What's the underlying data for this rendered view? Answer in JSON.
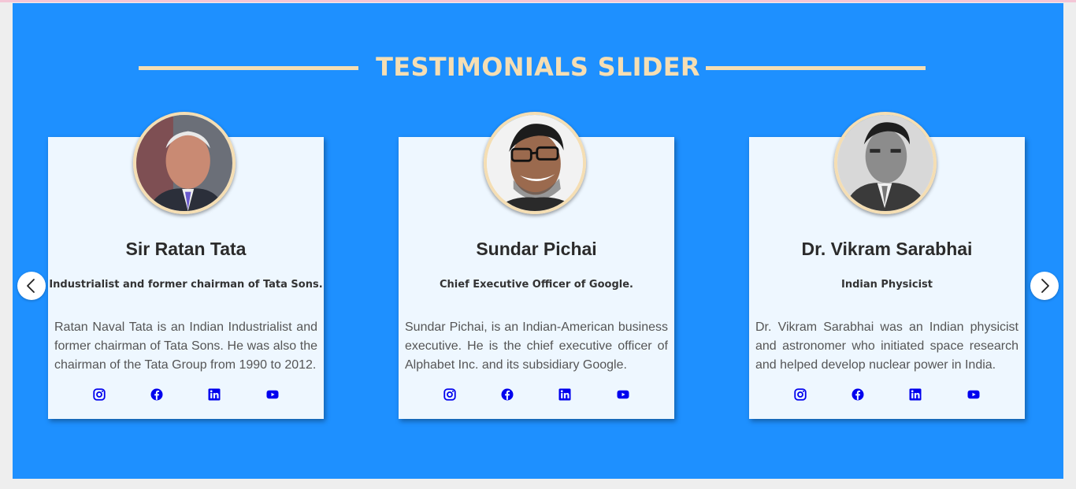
{
  "section": {
    "title": "TESTIMONIALS SLIDER",
    "background": "#1e90ff",
    "accent": "#f5deb3"
  },
  "navigation": {
    "prev_icon": "chevron-left-icon",
    "next_icon": "chevron-right-icon"
  },
  "cards": [
    {
      "name": "Sir Ratan Tata",
      "role": "Industrialist and former chairman of Tata Sons.",
      "description": "Ratan Naval Tata is an Indian Industrialist and former chairman of Tata Sons. He was also the chairman of the Tata Group from 1990 to 2012.",
      "photo": "portrait-ratan-tata"
    },
    {
      "name": "Sundar Pichai",
      "role": "Chief Executive Officer of Google.",
      "description": "Sundar Pichai, is an Indian-American business executive. He is the chief executive officer of Alphabet Inc. and its subsidiary Google.",
      "photo": "portrait-sundar-pichai"
    },
    {
      "name": "Dr. Vikram Sarabhai",
      "role": "Indian Physicist",
      "description": "Dr. Vikram Sarabhai was an Indian physicist and astronomer who initiated space research and helped develop nuclear power in India.",
      "photo": "portrait-vikram-sarabhai"
    }
  ],
  "social_icons": [
    "instagram-icon",
    "facebook-icon",
    "linkedin-icon",
    "youtube-icon"
  ],
  "icon_color": "#0000ee"
}
